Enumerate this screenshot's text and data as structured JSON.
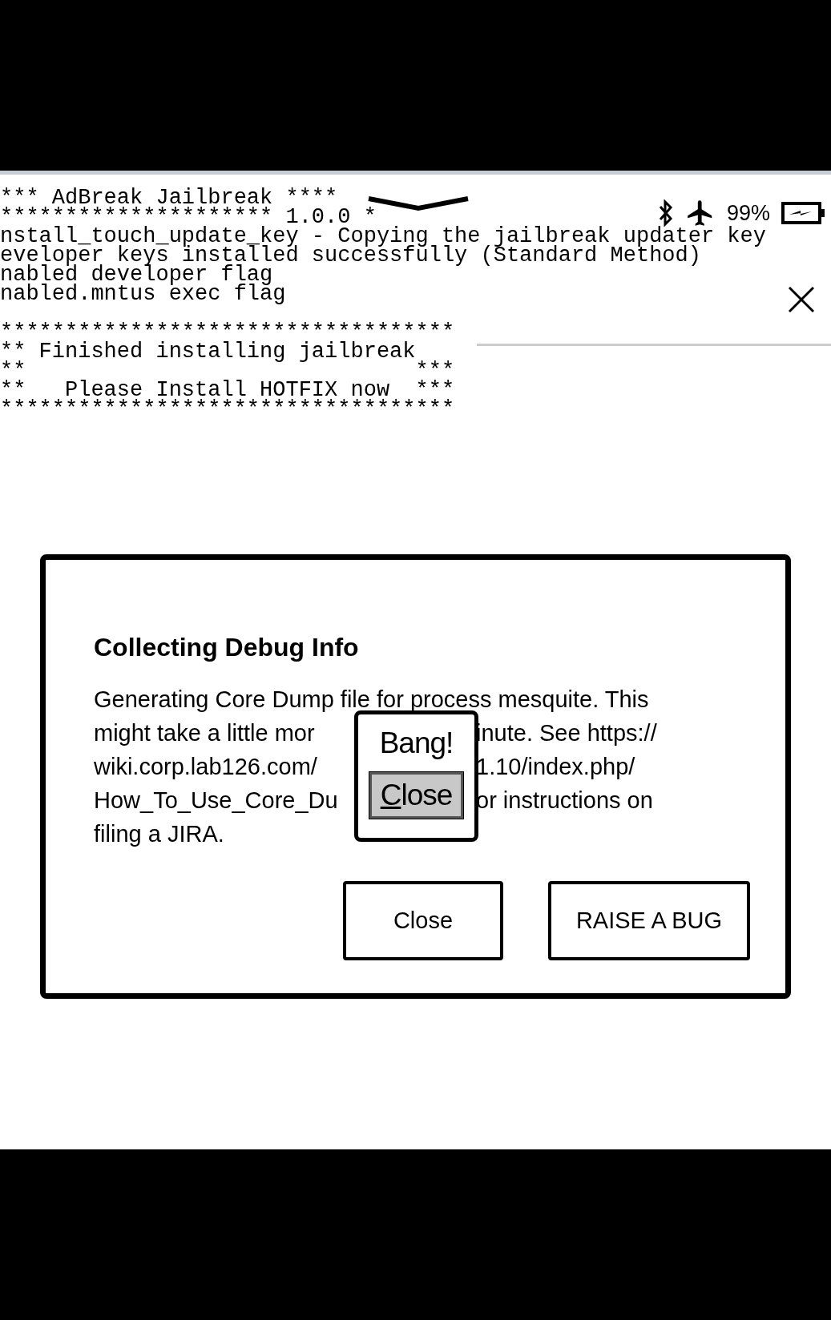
{
  "terminal": {
    "blocks": [
      [
        "*** AdBreak Jailbreak ****",
        "********************* 1.0.0 *",
        "nstall_touch_update_key - Copying the jailbreak updater key",
        "eveloper keys installed successfully (Standard Method)",
        "nabled developer flag",
        "nabled.mntus exec flag"
      ],
      [
        "***********************************",
        "** Finished installing jailbreak",
        "**                              ***",
        "**   Please Install HOTFIX now  ***",
        "***********************************"
      ]
    ]
  },
  "status_bar": {
    "bluetooth": true,
    "airplane_mode": true,
    "battery": "99%",
    "charging": true
  },
  "dialog": {
    "title": "Collecting Debug Info",
    "body_lines": [
      {
        "left": "Generating Core Dump file for process mesquite. This"
      },
      {
        "left": "might take a little mor",
        "right": "inute. See https://"
      },
      {
        "left": "wiki.corp.lab126.com/",
        "right": "1.10/index.php/"
      },
      {
        "left": "How_To_Use_Core_Du",
        "right": "or instructions on"
      },
      {
        "left": "filing a JIRA."
      }
    ],
    "buttons": [
      "Close",
      "RAISE A BUG"
    ]
  },
  "popup": {
    "message": "Bang!",
    "button": "Close"
  }
}
